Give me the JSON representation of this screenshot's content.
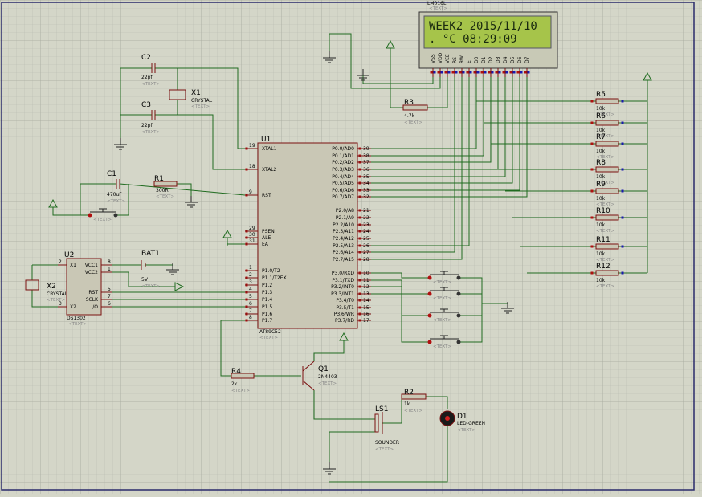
{
  "lcd": {
    "ref": "LM016L",
    "line1": "WEEK2 2015/11/10",
    "line2": "  . °C 08:29:09",
    "pins": [
      "VSS",
      "VDD",
      "VEE",
      "RS",
      "RW",
      "E",
      "D0",
      "D1",
      "D2",
      "D3",
      "D4",
      "D5",
      "D6",
      "D7"
    ]
  },
  "mcu": {
    "ref": "U1",
    "part": "AT89C52",
    "left_pins": [
      {
        "num": "19",
        "name": "XTAL1"
      },
      {
        "num": "18",
        "name": "XTAL2"
      },
      {
        "num": "9",
        "name": "RST"
      },
      {
        "num": "29",
        "name": "PSEN"
      },
      {
        "num": "30",
        "name": "ALE"
      },
      {
        "num": "31",
        "name": "EA"
      },
      {
        "num": "1",
        "name": "P1.0/T2"
      },
      {
        "num": "2",
        "name": "P1.1/T2EX"
      },
      {
        "num": "3",
        "name": "P1.2"
      },
      {
        "num": "4",
        "name": "P1.3"
      },
      {
        "num": "5",
        "name": "P1.4"
      },
      {
        "num": "6",
        "name": "P1.5"
      },
      {
        "num": "7",
        "name": "P1.6"
      },
      {
        "num": "8",
        "name": "P1.7"
      }
    ],
    "right_pins": [
      {
        "num": "39",
        "name": "P0.0/AD0"
      },
      {
        "num": "38",
        "name": "P0.1/AD1"
      },
      {
        "num": "37",
        "name": "P0.2/AD2"
      },
      {
        "num": "36",
        "name": "P0.3/AD3"
      },
      {
        "num": "35",
        "name": "P0.4/AD4"
      },
      {
        "num": "34",
        "name": "P0.5/AD5"
      },
      {
        "num": "33",
        "name": "P0.6/AD6"
      },
      {
        "num": "32",
        "name": "P0.7/AD7"
      },
      {
        "num": "21",
        "name": "P2.0/A8"
      },
      {
        "num": "22",
        "name": "P2.1/A9"
      },
      {
        "num": "23",
        "name": "P2.2/A10"
      },
      {
        "num": "24",
        "name": "P2.3/A11"
      },
      {
        "num": "25",
        "name": "P2.4/A12"
      },
      {
        "num": "26",
        "name": "P2.5/A13"
      },
      {
        "num": "27",
        "name": "P2.6/A14"
      },
      {
        "num": "28",
        "name": "P2.7/A15"
      },
      {
        "num": "10",
        "name": "P3.0/RXD"
      },
      {
        "num": "11",
        "name": "P3.1/TXD"
      },
      {
        "num": "12",
        "name": "P3.2/INT0"
      },
      {
        "num": "13",
        "name": "P3.3/INT1"
      },
      {
        "num": "14",
        "name": "P3.4/T0"
      },
      {
        "num": "15",
        "name": "P3.5/T1"
      },
      {
        "num": "16",
        "name": "P3.6/WR"
      },
      {
        "num": "17",
        "name": "P3.7/RD"
      }
    ]
  },
  "rtc": {
    "ref": "U2",
    "part": "DS1302",
    "left_pins": [
      {
        "num": "2",
        "name": "X1"
      },
      {
        "num": "3",
        "name": "X2"
      }
    ],
    "right_pins": [
      {
        "num": "8",
        "name": "VCC1"
      },
      {
        "num": "1",
        "name": "VCC2"
      },
      {
        "num": "5",
        "name": "RST"
      },
      {
        "num": "7",
        "name": "SCLK"
      },
      {
        "num": "6",
        "name": "I/O"
      }
    ]
  },
  "components": {
    "c2": {
      "ref": "C2",
      "value": "22pf"
    },
    "c3": {
      "ref": "C3",
      "value": "22pf"
    },
    "x1": {
      "ref": "X1",
      "value": "CRYSTAL"
    },
    "c1": {
      "ref": "C1",
      "value": "470uF"
    },
    "r1": {
      "ref": "R1",
      "value": "300R"
    },
    "x2": {
      "ref": "X2",
      "value": "CRYSTAL"
    },
    "bat1": {
      "ref": "BAT1",
      "value": "5V"
    },
    "r3": {
      "ref": "R3",
      "value": "4.7k"
    },
    "r4": {
      "ref": "R4",
      "value": "2k"
    },
    "q1": {
      "ref": "Q1",
      "value": "2N4403"
    },
    "r2": {
      "ref": "R2",
      "value": "1k"
    },
    "d1": {
      "ref": "D1",
      "value": "LED-GREEN"
    },
    "ls1": {
      "ref": "LS1",
      "value": "SOUNDER"
    }
  },
  "pullups": [
    {
      "ref": "R5",
      "value": "10k"
    },
    {
      "ref": "R6",
      "value": "10k"
    },
    {
      "ref": "R7",
      "value": "10k"
    },
    {
      "ref": "R8",
      "value": "10k"
    },
    {
      "ref": "R9",
      "value": "10k"
    },
    {
      "ref": "R10",
      "value": "10k"
    },
    {
      "ref": "R11",
      "value": "10k"
    },
    {
      "ref": "R12",
      "value": "10k"
    }
  ],
  "text_placeholder": "<TEXT>"
}
